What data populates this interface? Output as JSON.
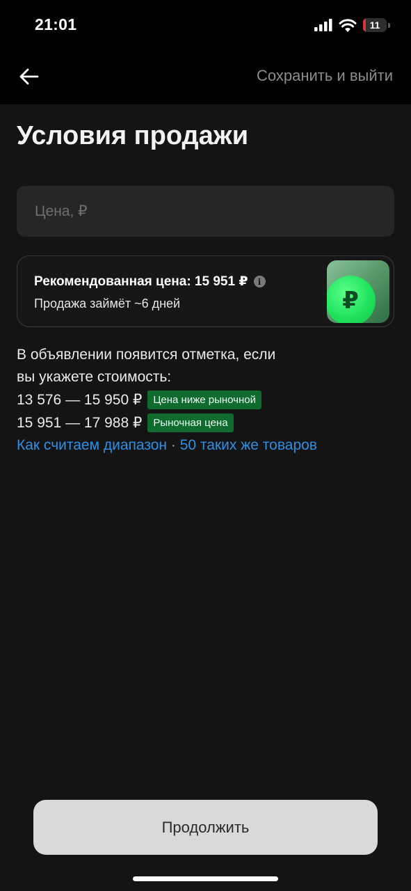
{
  "status_bar": {
    "time": "21:01",
    "battery_level": "11",
    "battery_color": "#e0323a"
  },
  "nav": {
    "back_icon": "arrow-left-icon",
    "save_exit_label": "Сохранить и выйти"
  },
  "page": {
    "title": "Условия продажи"
  },
  "price_input": {
    "value": "",
    "placeholder": "Цена, ₽"
  },
  "recommendation": {
    "title": "Рекомендованная цена: 15 951 ₽",
    "info_icon": "info-icon",
    "subtitle": "Продажа займёт ~6 дней",
    "badge_symbol": "₽",
    "badge_icon": "ruble-coin-icon"
  },
  "info": {
    "line1": "В объявлении появится отметка, если",
    "line2": "вы укажете стоимость:",
    "ranges": [
      {
        "range": "13 576 — 15 950 ₽",
        "tag": "Цена ниже рыночной"
      },
      {
        "range": "15 951 — 17 988 ₽",
        "tag": "Рыночная цена"
      }
    ],
    "link_range": "Как считаем диапазон",
    "separator": "·",
    "link_similar": "50 таких же товаров"
  },
  "actions": {
    "continue_label": "Продолжить"
  },
  "colors": {
    "background": "#141414",
    "tag_green": "#0f6b2e",
    "link_blue": "#2e8fe6",
    "button_bg": "#d9d9d9"
  }
}
